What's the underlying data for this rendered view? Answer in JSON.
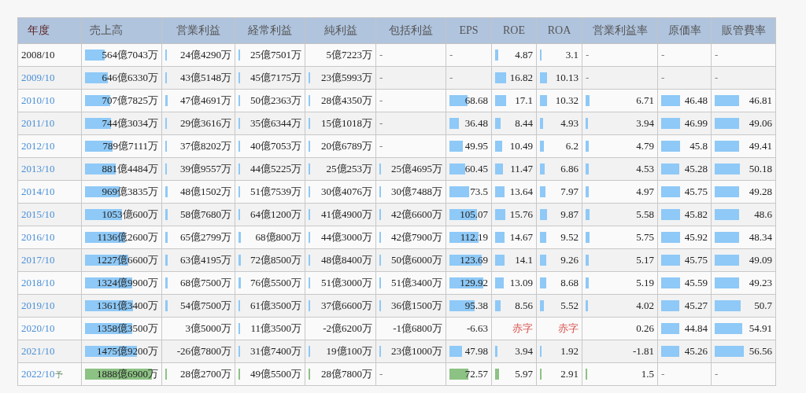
{
  "table": {
    "columns": [
      "年度",
      "売上高",
      "営業利益",
      "経常利益",
      "純利益",
      "包括利益",
      "EPS",
      "ROE",
      "ROA",
      "営業利益率",
      "原価率",
      "販管費率"
    ],
    "rows": [
      {
        "forecast": false,
        "cells": [
          {
            "kind": "year",
            "text": "2008/10",
            "link": false
          },
          {
            "kind": "bar",
            "text": "564億7043万",
            "level": 0.27
          },
          {
            "kind": "bar",
            "text": "24億4290万",
            "level": 0.01
          },
          {
            "kind": "bar",
            "text": "25億7501万",
            "level": 0.01
          },
          {
            "kind": "number",
            "text": "5億7223万"
          },
          {
            "kind": "dash",
            "text": "-"
          },
          {
            "kind": "dash",
            "text": "-"
          },
          {
            "kind": "bar",
            "text": "4.87",
            "level": 0.08
          },
          {
            "kind": "bar",
            "text": "3.1",
            "level": 0.05
          },
          {
            "kind": "dash",
            "text": "-"
          },
          {
            "kind": "dash",
            "text": "-"
          },
          {
            "kind": "dash",
            "text": "-"
          }
        ]
      },
      {
        "forecast": false,
        "cells": [
          {
            "kind": "year",
            "text": "2009/10",
            "link": true
          },
          {
            "kind": "bar",
            "text": "646億6330万",
            "level": 0.31
          },
          {
            "kind": "bar",
            "text": "43億5148万",
            "level": 0.02
          },
          {
            "kind": "bar",
            "text": "45億7175万",
            "level": 0.02
          },
          {
            "kind": "bar",
            "text": "23億5993万",
            "level": 0.02
          },
          {
            "kind": "dash",
            "text": "-"
          },
          {
            "kind": "dash",
            "text": "-"
          },
          {
            "kind": "bar",
            "text": "16.82",
            "level": 0.3
          },
          {
            "kind": "bar",
            "text": "10.13",
            "level": 0.19
          },
          {
            "kind": "dash",
            "text": "-"
          },
          {
            "kind": "dash",
            "text": "-"
          },
          {
            "kind": "dash",
            "text": "-"
          }
        ]
      },
      {
        "forecast": false,
        "cells": [
          {
            "kind": "year",
            "text": "2010/10",
            "link": true
          },
          {
            "kind": "bar",
            "text": "707億7825万",
            "level": 0.34
          },
          {
            "kind": "bar",
            "text": "47億4691万",
            "level": 0.03
          },
          {
            "kind": "bar",
            "text": "50億2363万",
            "level": 0.03
          },
          {
            "kind": "bar",
            "text": "28億4350万",
            "level": 0.02
          },
          {
            "kind": "dash",
            "text": "-"
          },
          {
            "kind": "bar",
            "text": "68.68",
            "level": 0.47
          },
          {
            "kind": "bar",
            "text": "17.1",
            "level": 0.3
          },
          {
            "kind": "bar",
            "text": "10.32",
            "level": 0.19
          },
          {
            "kind": "bar",
            "text": "6.71",
            "level": 0.06
          },
          {
            "kind": "bar",
            "text": "46.48",
            "level": 0.4
          },
          {
            "kind": "bar",
            "text": "46.81",
            "level": 0.42
          }
        ]
      },
      {
        "forecast": false,
        "cells": [
          {
            "kind": "year",
            "text": "2011/10",
            "link": true
          },
          {
            "kind": "bar",
            "text": "744億3034万",
            "level": 0.36
          },
          {
            "kind": "bar",
            "text": "29億3616万",
            "level": 0.02
          },
          {
            "kind": "bar",
            "text": "35億6344万",
            "level": 0.02
          },
          {
            "kind": "bar",
            "text": "15億1018万",
            "level": 0.01
          },
          {
            "kind": "dash",
            "text": "-"
          },
          {
            "kind": "bar",
            "text": "36.48",
            "level": 0.25
          },
          {
            "kind": "bar",
            "text": "8.44",
            "level": 0.15
          },
          {
            "kind": "bar",
            "text": "4.93",
            "level": 0.09
          },
          {
            "kind": "bar",
            "text": "3.94",
            "level": 0.04
          },
          {
            "kind": "bar",
            "text": "46.99",
            "level": 0.4
          },
          {
            "kind": "bar",
            "text": "49.06",
            "level": 0.43
          }
        ]
      },
      {
        "forecast": false,
        "cells": [
          {
            "kind": "year",
            "text": "2012/10",
            "link": true
          },
          {
            "kind": "bar",
            "text": "789億7111万",
            "level": 0.38
          },
          {
            "kind": "bar",
            "text": "37億8202万",
            "level": 0.02
          },
          {
            "kind": "bar",
            "text": "40億7053万",
            "level": 0.02
          },
          {
            "kind": "bar",
            "text": "20億6789万",
            "level": 0.02
          },
          {
            "kind": "dash",
            "text": "-"
          },
          {
            "kind": "bar",
            "text": "49.95",
            "level": 0.34
          },
          {
            "kind": "bar",
            "text": "10.49",
            "level": 0.18
          },
          {
            "kind": "bar",
            "text": "6.2",
            "level": 0.11
          },
          {
            "kind": "bar",
            "text": "4.79",
            "level": 0.05
          },
          {
            "kind": "bar",
            "text": "45.8",
            "level": 0.4
          },
          {
            "kind": "bar",
            "text": "49.41",
            "level": 0.43
          }
        ]
      },
      {
        "forecast": false,
        "cells": [
          {
            "kind": "year",
            "text": "2013/10",
            "link": true
          },
          {
            "kind": "bar",
            "text": "881億4484万",
            "level": 0.42
          },
          {
            "kind": "bar",
            "text": "39億9557万",
            "level": 0.02
          },
          {
            "kind": "bar",
            "text": "44億5225万",
            "level": 0.02
          },
          {
            "kind": "bar",
            "text": "25億253万",
            "level": 0.02
          },
          {
            "kind": "bar",
            "text": "25億4695万",
            "level": 0.01
          },
          {
            "kind": "bar",
            "text": "60.45",
            "level": 0.41
          },
          {
            "kind": "bar",
            "text": "11.47",
            "level": 0.2
          },
          {
            "kind": "bar",
            "text": "6.86",
            "level": 0.12
          },
          {
            "kind": "bar",
            "text": "4.53",
            "level": 0.05
          },
          {
            "kind": "bar",
            "text": "45.28",
            "level": 0.39
          },
          {
            "kind": "bar",
            "text": "50.18",
            "level": 0.44
          }
        ]
      },
      {
        "forecast": false,
        "cells": [
          {
            "kind": "year",
            "text": "2014/10",
            "link": true
          },
          {
            "kind": "bar",
            "text": "969億3835万",
            "level": 0.47
          },
          {
            "kind": "bar",
            "text": "48億1502万",
            "level": 0.03
          },
          {
            "kind": "bar",
            "text": "51億7539万",
            "level": 0.03
          },
          {
            "kind": "bar",
            "text": "30億4076万",
            "level": 0.02
          },
          {
            "kind": "bar",
            "text": "30億7488万",
            "level": 0.01
          },
          {
            "kind": "bar",
            "text": "73.5",
            "level": 0.5
          },
          {
            "kind": "bar",
            "text": "13.64",
            "level": 0.24
          },
          {
            "kind": "bar",
            "text": "7.97",
            "level": 0.15
          },
          {
            "kind": "bar",
            "text": "4.97",
            "level": 0.05
          },
          {
            "kind": "bar",
            "text": "45.75",
            "level": 0.4
          },
          {
            "kind": "bar",
            "text": "49.28",
            "level": 0.43
          }
        ]
      },
      {
        "forecast": false,
        "cells": [
          {
            "kind": "year",
            "text": "2015/10",
            "link": true
          },
          {
            "kind": "bar",
            "text": "1053億600万",
            "level": 0.51
          },
          {
            "kind": "bar",
            "text": "58億7680万",
            "level": 0.03
          },
          {
            "kind": "bar",
            "text": "64億1200万",
            "level": 0.03
          },
          {
            "kind": "bar",
            "text": "41億4900万",
            "level": 0.02
          },
          {
            "kind": "bar",
            "text": "42億6600万",
            "level": 0.01
          },
          {
            "kind": "bar",
            "text": "105.07",
            "level": 0.72
          },
          {
            "kind": "bar",
            "text": "15.76",
            "level": 0.28
          },
          {
            "kind": "bar",
            "text": "9.87",
            "level": 0.18
          },
          {
            "kind": "bar",
            "text": "5.58",
            "level": 0.06
          },
          {
            "kind": "bar",
            "text": "45.82",
            "level": 0.4
          },
          {
            "kind": "bar",
            "text": "48.6",
            "level": 0.43
          }
        ]
      },
      {
        "forecast": false,
        "cells": [
          {
            "kind": "year",
            "text": "2016/10",
            "link": true
          },
          {
            "kind": "bar",
            "text": "1136億2600万",
            "level": 0.55
          },
          {
            "kind": "bar",
            "text": "65億2799万",
            "level": 0.03
          },
          {
            "kind": "bar",
            "text": "68億800万",
            "level": 0.04
          },
          {
            "kind": "bar",
            "text": "44億3000万",
            "level": 0.02
          },
          {
            "kind": "bar",
            "text": "42億7900万",
            "level": 0.01
          },
          {
            "kind": "bar",
            "text": "112.19",
            "level": 0.76
          },
          {
            "kind": "bar",
            "text": "14.67",
            "level": 0.26
          },
          {
            "kind": "bar",
            "text": "9.52",
            "level": 0.17
          },
          {
            "kind": "bar",
            "text": "5.75",
            "level": 0.06
          },
          {
            "kind": "bar",
            "text": "45.92",
            "level": 0.4
          },
          {
            "kind": "bar",
            "text": "48.34",
            "level": 0.42
          }
        ]
      },
      {
        "forecast": false,
        "cells": [
          {
            "kind": "year",
            "text": "2017/10",
            "link": true
          },
          {
            "kind": "bar",
            "text": "1227億6600万",
            "level": 0.59
          },
          {
            "kind": "bar",
            "text": "63億4195万",
            "level": 0.03
          },
          {
            "kind": "bar",
            "text": "72億8500万",
            "level": 0.04
          },
          {
            "kind": "bar",
            "text": "48億8400万",
            "level": 0.03
          },
          {
            "kind": "bar",
            "text": "50億6000万",
            "level": 0.01
          },
          {
            "kind": "bar",
            "text": "123.69",
            "level": 0.84
          },
          {
            "kind": "bar",
            "text": "14.1",
            "level": 0.25
          },
          {
            "kind": "bar",
            "text": "9.26",
            "level": 0.17
          },
          {
            "kind": "bar",
            "text": "5.17",
            "level": 0.05
          },
          {
            "kind": "bar",
            "text": "45.75",
            "level": 0.4
          },
          {
            "kind": "bar",
            "text": "49.09",
            "level": 0.43
          }
        ]
      },
      {
        "forecast": false,
        "cells": [
          {
            "kind": "year",
            "text": "2018/10",
            "link": true
          },
          {
            "kind": "bar",
            "text": "1324億9900万",
            "level": 0.64
          },
          {
            "kind": "bar",
            "text": "68億7500万",
            "level": 0.04
          },
          {
            "kind": "bar",
            "text": "76億5500万",
            "level": 0.04
          },
          {
            "kind": "bar",
            "text": "51億3000万",
            "level": 0.03
          },
          {
            "kind": "bar",
            "text": "51億3400万",
            "level": 0.01
          },
          {
            "kind": "bar",
            "text": "129.92",
            "level": 0.88
          },
          {
            "kind": "bar",
            "text": "13.09",
            "level": 0.23
          },
          {
            "kind": "bar",
            "text": "8.68",
            "level": 0.16
          },
          {
            "kind": "bar",
            "text": "5.19",
            "level": 0.05
          },
          {
            "kind": "bar",
            "text": "45.59",
            "level": 0.4
          },
          {
            "kind": "bar",
            "text": "49.23",
            "level": 0.43
          }
        ]
      },
      {
        "forecast": false,
        "cells": [
          {
            "kind": "year",
            "text": "2019/10",
            "link": true
          },
          {
            "kind": "bar",
            "text": "1361億3400万",
            "level": 0.66
          },
          {
            "kind": "bar",
            "text": "54億7500万",
            "level": 0.03
          },
          {
            "kind": "bar",
            "text": "61億3500万",
            "level": 0.03
          },
          {
            "kind": "bar",
            "text": "37億6600万",
            "level": 0.02
          },
          {
            "kind": "bar",
            "text": "36億1500万",
            "level": 0.01
          },
          {
            "kind": "bar",
            "text": "95.38",
            "level": 0.65
          },
          {
            "kind": "bar",
            "text": "8.56",
            "level": 0.15
          },
          {
            "kind": "bar",
            "text": "5.52",
            "level": 0.1
          },
          {
            "kind": "bar",
            "text": "4.02",
            "level": 0.04
          },
          {
            "kind": "bar",
            "text": "45.27",
            "level": 0.39
          },
          {
            "kind": "bar",
            "text": "50.7",
            "level": 0.45
          }
        ]
      },
      {
        "forecast": false,
        "cells": [
          {
            "kind": "year",
            "text": "2020/10",
            "link": true
          },
          {
            "kind": "bar",
            "text": "1358億3500万",
            "level": 0.65
          },
          {
            "kind": "number",
            "text": "3億5000万"
          },
          {
            "kind": "bar",
            "text": "11億3500万",
            "level": 0.01
          },
          {
            "kind": "number",
            "text": "-2億6200万"
          },
          {
            "kind": "number",
            "text": "-1億6800万"
          },
          {
            "kind": "number",
            "text": "-6.63"
          },
          {
            "kind": "deficit",
            "text": "赤字"
          },
          {
            "kind": "deficit",
            "text": "赤字"
          },
          {
            "kind": "number",
            "text": "0.26"
          },
          {
            "kind": "bar",
            "text": "44.84",
            "level": 0.39
          },
          {
            "kind": "bar",
            "text": "54.91",
            "level": 0.48
          }
        ]
      },
      {
        "forecast": false,
        "cells": [
          {
            "kind": "year",
            "text": "2021/10",
            "link": true
          },
          {
            "kind": "bar",
            "text": "1475億9200万",
            "level": 0.71
          },
          {
            "kind": "number",
            "text": "-26億7800万"
          },
          {
            "kind": "bar",
            "text": "31億7400万",
            "level": 0.02
          },
          {
            "kind": "bar",
            "text": "19億100万",
            "level": 0.01
          },
          {
            "kind": "bar",
            "text": "23億1000万",
            "level": 0.01
          },
          {
            "kind": "bar",
            "text": "47.98",
            "level": 0.33
          },
          {
            "kind": "bar",
            "text": "3.94",
            "level": 0.07
          },
          {
            "kind": "bar",
            "text": "1.92",
            "level": 0.03
          },
          {
            "kind": "number",
            "text": "-1.81"
          },
          {
            "kind": "bar",
            "text": "45.26",
            "level": 0.39
          },
          {
            "kind": "bar",
            "text": "56.56",
            "level": 0.5
          }
        ]
      },
      {
        "forecast": true,
        "cells": [
          {
            "kind": "year",
            "text": "2022/10",
            "link": true,
            "mark": "予"
          },
          {
            "kind": "bar",
            "text": "1888億6900万",
            "level": 0.91
          },
          {
            "kind": "bar",
            "text": "28億2700万",
            "level": 0.01
          },
          {
            "kind": "bar",
            "text": "49億5500万",
            "level": 0.03
          },
          {
            "kind": "bar",
            "text": "28億7800万",
            "level": 0.02
          },
          {
            "kind": "dash",
            "text": "-"
          },
          {
            "kind": "bar",
            "text": "72.57",
            "level": 0.49
          },
          {
            "kind": "bar",
            "text": "5.97",
            "level": 0.1
          },
          {
            "kind": "bar",
            "text": "2.91",
            "level": 0.04
          },
          {
            "kind": "bar",
            "text": "1.5",
            "level": 0.01
          },
          {
            "kind": "dash",
            "text": "-"
          },
          {
            "kind": "dash",
            "text": "-"
          }
        ]
      }
    ]
  }
}
